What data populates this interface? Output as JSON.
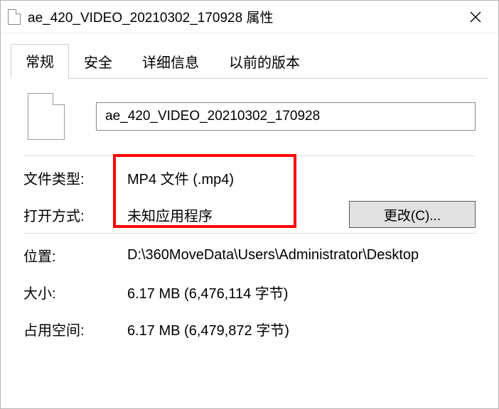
{
  "window": {
    "title": "ae_420_VIDEO_20210302_170928 属性"
  },
  "tabs": [
    {
      "label": "常规",
      "active": true
    },
    {
      "label": "安全",
      "active": false
    },
    {
      "label": "详细信息",
      "active": false
    },
    {
      "label": "以前的版本",
      "active": false
    }
  ],
  "filename": "ae_420_VIDEO_20210302_170928",
  "labels": {
    "file_type": "文件类型:",
    "open_with": "打开方式:",
    "location": "位置:",
    "size": "大小:",
    "size_on_disk": "占用空间:"
  },
  "values": {
    "file_type": "MP4 文件 (.mp4)",
    "open_with": "未知应用程序",
    "location": "D:\\360MoveData\\Users\\Administrator\\Desktop",
    "size": "6.17 MB (6,476,114 字节)",
    "size_on_disk": "6.17 MB (6,479,872 字节)"
  },
  "buttons": {
    "change": "更改(C)..."
  }
}
